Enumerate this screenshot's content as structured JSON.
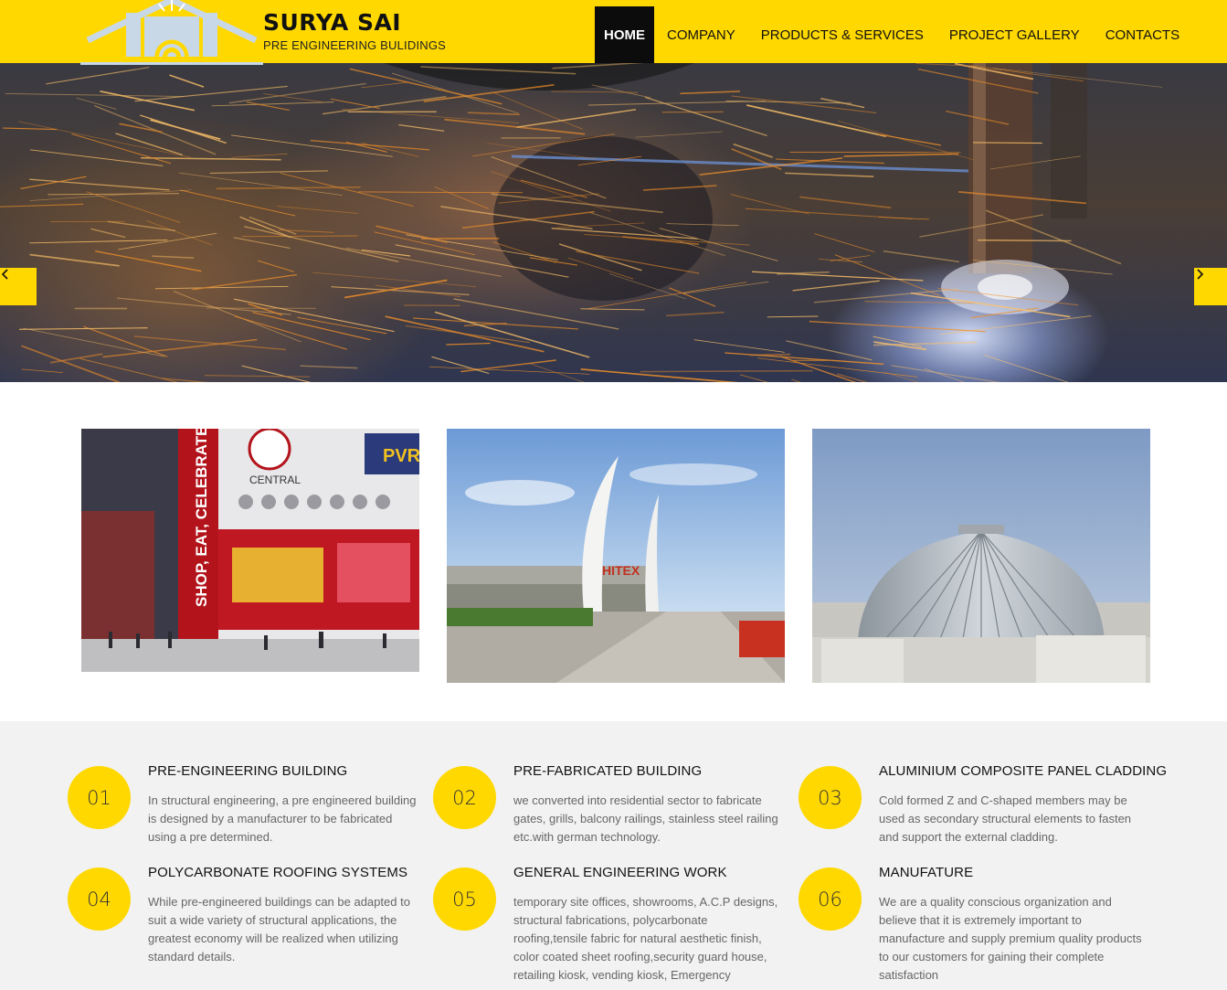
{
  "header": {
    "brand_name": "SURYA SAI",
    "brand_tagline": "PRE ENGINEERING BULIDINGS",
    "nav": [
      {
        "label": "HOME",
        "active": true
      },
      {
        "label": "COMPANY",
        "active": false
      },
      {
        "label": "PRODUCTS & SERVICES",
        "active": false
      },
      {
        "label": "PROJECT GALLERY",
        "active": false
      },
      {
        "label": "CONTACTS",
        "active": false
      }
    ]
  },
  "hero": {
    "image": "welding-sparks-photo",
    "prev_icon": "chevron-left-icon",
    "next_icon": "chevron-right-icon"
  },
  "gallery": [
    {
      "image": "mall-building-photo",
      "signage": [
        "SHOP, EAT, CELEBRATE",
        "CENTRAL",
        "PVR"
      ]
    },
    {
      "image": "hitex-arch-photo",
      "signage": [
        "HITEX"
      ]
    },
    {
      "image": "aluminium-dome-photo"
    }
  ],
  "services": [
    {
      "num": "01",
      "title": "PRE-ENGINEERING BUILDING",
      "text": "In structural engineering, a pre engineered building is designed by a manufacturer to be fabricated using a pre determined."
    },
    {
      "num": "02",
      "title": "PRE-FABRICATED BUILDING",
      "text": "we converted into residential sector to fabricate gates, grills, balcony railings, stainless steel railing etc.with german technology."
    },
    {
      "num": "03",
      "title": "ALUMINIUM COMPOSITE PANEL CLADDING",
      "text": "Cold formed Z and C-shaped members may be used as secondary structural elements to fasten and support the external cladding."
    },
    {
      "num": "04",
      "title": "POLYCARBONATE ROOFING SYSTEMS",
      "text": "While pre-engineered buildings can be adapted to suit a wide variety of structural applications, the greatest economy will be realized when utilizing standard details."
    },
    {
      "num": "05",
      "title": "GENERAL ENGINEERING WORK",
      "text": "temporary site offices, showrooms, A.C.P designs, structural fabrications, polycarbonate roofing,tensile fabric for natural aesthetic finish, color coated sheet roofing,security guard house, retailing kiosk, vending kiosk, Emergency"
    },
    {
      "num": "06",
      "title": "MANUFATURE",
      "text": "We are a quality conscious organization and believe that it is extremely important to manufacture and supply premium quality products to our customers for gaining their complete satisfaction"
    }
  ],
  "colors": {
    "accent": "#ffd800",
    "nav_active_bg": "#0c0c0c",
    "section_bg": "#f2f2f2"
  }
}
